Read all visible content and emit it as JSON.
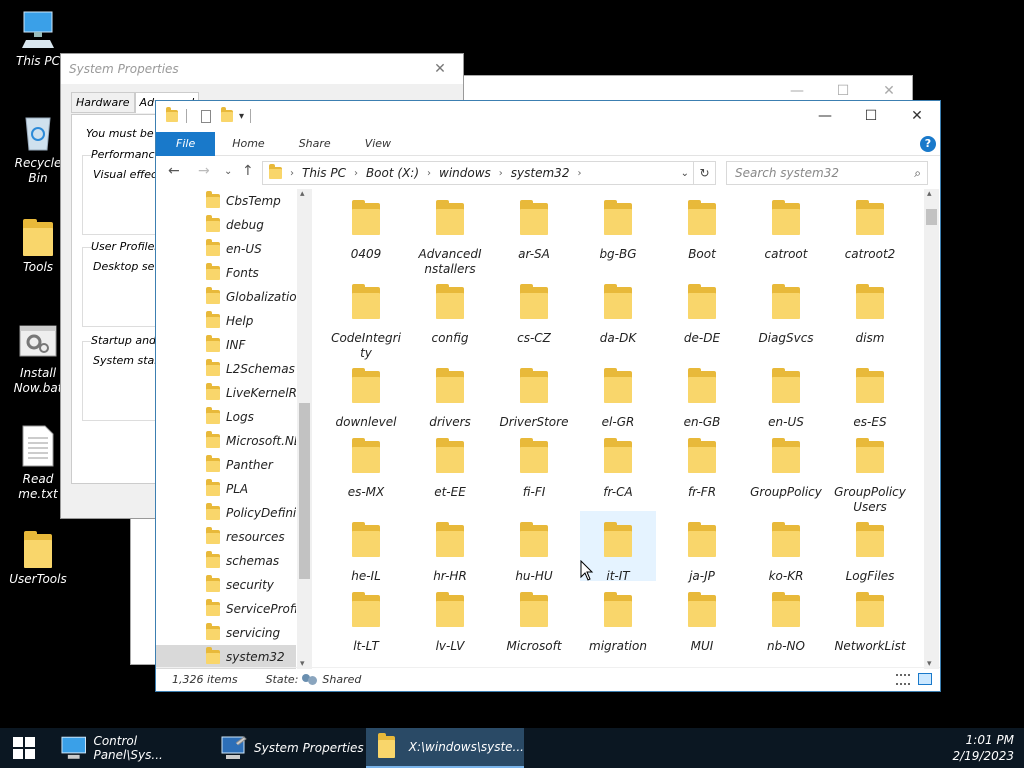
{
  "desktop": {
    "icons": [
      {
        "label": "This PC",
        "icon": "computer-icon"
      },
      {
        "label": "Recycle Bin",
        "icon": "recycle-bin-icon"
      },
      {
        "label": "Tools",
        "icon": "folder-icon"
      },
      {
        "label": "Install Now.bat",
        "icon": "batch-file-icon"
      },
      {
        "label": "Read me.txt",
        "icon": "text-file-icon"
      },
      {
        "label": "UserTools",
        "icon": "folder-shortcut-icon"
      }
    ]
  },
  "system_properties": {
    "title": "System Properties",
    "tabs": [
      "Hardware",
      "Advanced"
    ],
    "logged_in_text": "You must be lo",
    "performance": {
      "group": "Performance",
      "text": "Visual effects"
    },
    "user_profiles": {
      "group": "User Profiles",
      "text": "Desktop setti"
    },
    "startup": {
      "group": "Startup and R",
      "text": "System startup"
    }
  },
  "explorer": {
    "ribbon_tabs": [
      "File",
      "Home",
      "Share",
      "View"
    ],
    "breadcrumbs": [
      "This PC",
      "Boot (X:)",
      "windows",
      "system32"
    ],
    "search_placeholder": "Search system32",
    "nav_items": [
      "CbsTemp",
      "debug",
      "en-US",
      "Fonts",
      "Globalization",
      "Help",
      "INF",
      "L2Schemas",
      "LiveKernelRep",
      "Logs",
      "Microsoft.NET",
      "Panther",
      "PLA",
      "PolicyDefiniti",
      "resources",
      "schemas",
      "security",
      "ServiceProfile",
      "servicing",
      "system32"
    ],
    "selected_nav": "system32",
    "folders": [
      [
        "0409",
        "AdvancedI nstallers",
        "ar-SA",
        "bg-BG",
        "Boot",
        "catroot",
        "catroot2"
      ],
      [
        "CodeIntegri ty",
        "config",
        "cs-CZ",
        "da-DK",
        "de-DE",
        "DiagSvcs",
        "dism"
      ],
      [
        "downlevel",
        "drivers",
        "DriverStore",
        "el-GR",
        "en-GB",
        "en-US",
        "es-ES"
      ],
      [
        "es-MX",
        "et-EE",
        "fi-FI",
        "fr-CA",
        "fr-FR",
        "GroupPolicy",
        "GroupPolicy Users"
      ],
      [
        "he-IL",
        "hr-HR",
        "hu-HU",
        "it-IT",
        "ja-JP",
        "ko-KR",
        "LogFiles"
      ],
      [
        "lt-LT",
        "lv-LV",
        "Microsoft",
        "migration",
        "MUI",
        "nb-NO",
        "NetworkList"
      ]
    ],
    "hovered_folder": "it-IT",
    "status": {
      "items": "1,326 items",
      "state_label": "State:",
      "state_value": "Shared"
    }
  },
  "taskbar": {
    "items": [
      {
        "label": "Control Panel\\Sys..."
      },
      {
        "label": "System Properties"
      },
      {
        "label": "X:\\windows\\syste..."
      }
    ],
    "time": "1:01 PM",
    "date": "2/19/2023"
  },
  "colors": {
    "accent": "#1979ca",
    "folder_front": "#f9d66b",
    "folder_back": "#e8b93a",
    "taskbar": "#0b1722"
  }
}
